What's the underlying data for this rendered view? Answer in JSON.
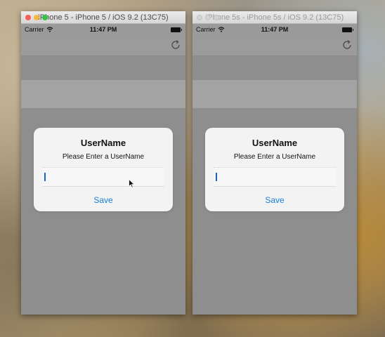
{
  "simulators": [
    {
      "window_title": "iPhone 5 - iPhone 5 / iOS 9.2 (13C75)",
      "carrier": "Carrier",
      "time": "11:47 PM",
      "alert": {
        "title": "UserName",
        "message": "Please Enter a UserName",
        "text_field_value": "",
        "button_label": "Save"
      }
    },
    {
      "window_title": "iPhone 5s - iPhone 5s / iOS 9.2 (13C75)",
      "carrier": "Carrier",
      "time": "11:47 PM",
      "alert": {
        "title": "UserName",
        "message": "Please Enter a UserName",
        "text_field_value": "",
        "button_label": "Save"
      }
    }
  ],
  "icons": {
    "refresh": "refresh-icon",
    "wifi": "wifi-icon",
    "battery": "battery-icon",
    "cursor": "cursor-icon"
  },
  "colors": {
    "accent": "#1a7fd6",
    "dimmed_background": "#8e8e8e",
    "alert_background": "#f3f3f3"
  }
}
